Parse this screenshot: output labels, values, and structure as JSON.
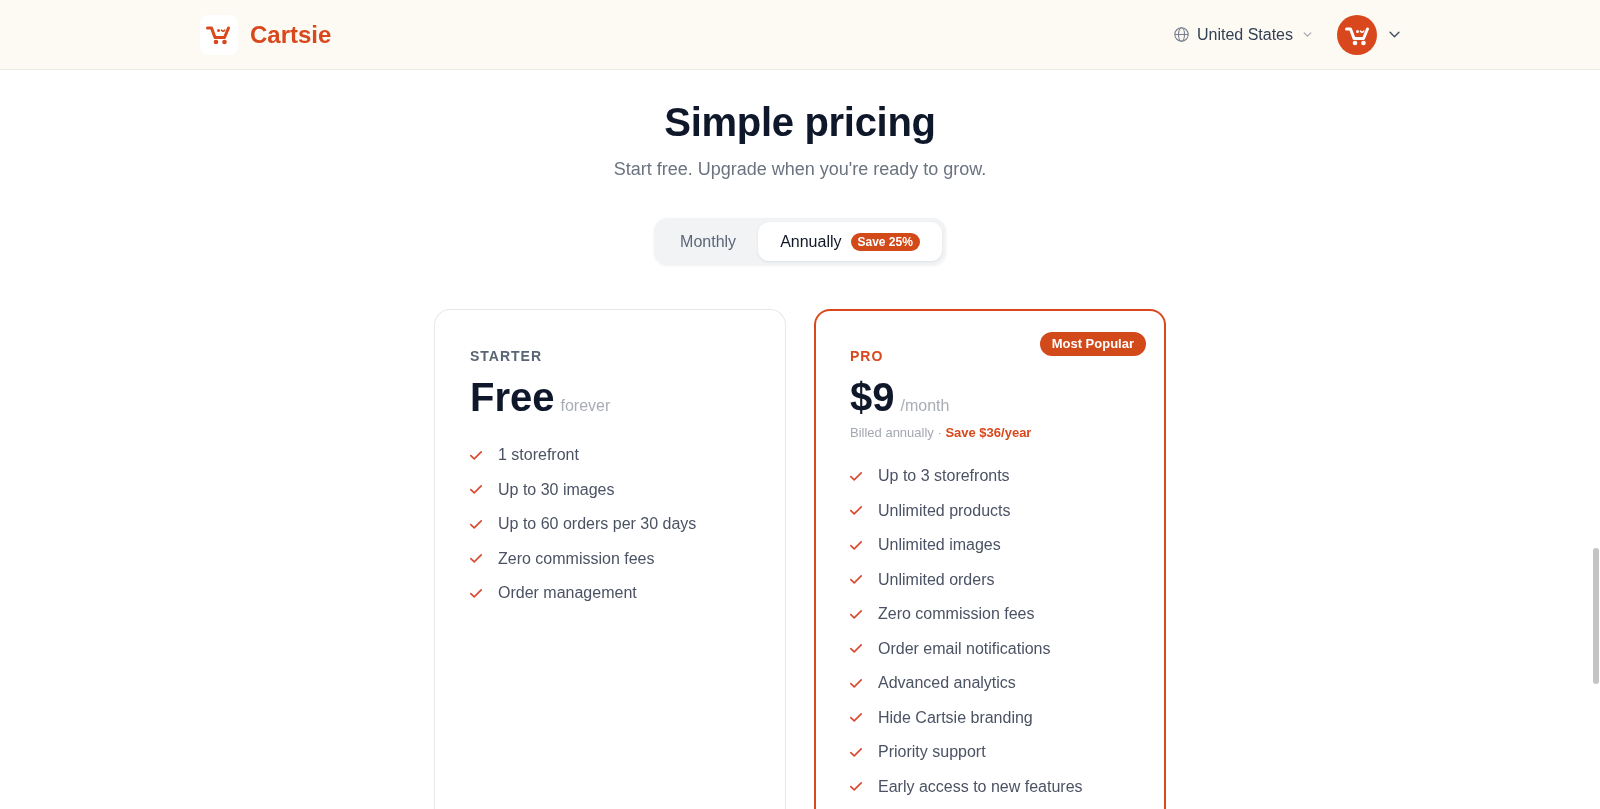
{
  "header": {
    "brand": "Cartsie",
    "region_selector": {
      "label": "United States"
    }
  },
  "hero": {
    "title": "Simple pricing",
    "subtitle": "Start free. Upgrade when you're ready to grow."
  },
  "billing_toggle": [
    {
      "label": "Monthly",
      "selected": false
    },
    {
      "label": "Annually",
      "selected": true,
      "badge": "Save 25%"
    }
  ],
  "plans": [
    {
      "name": "STARTER",
      "featured": false,
      "price": "Free",
      "period": "forever",
      "features": [
        "1 storefront",
        "Up to 30 images",
        "Up to 60 orders per 30 days",
        "Zero commission fees",
        "Order management"
      ]
    },
    {
      "name": "PRO",
      "featured": true,
      "badge": "Most Popular",
      "price": "$9",
      "period": "/month",
      "note": "Billed annually · **Save $36/year**",
      "features": [
        "Up to 3 storefronts",
        "Unlimited products",
        "Unlimited images",
        "Unlimited orders",
        "Zero commission fees",
        "Order email notifications",
        "Advanced analytics",
        "Hide Cartsie branding",
        "Priority support",
        "Early access to new features"
      ]
    }
  ]
}
